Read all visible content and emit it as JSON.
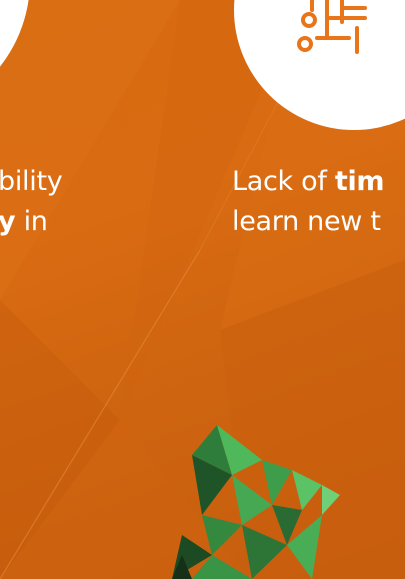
{
  "captions": {
    "left_line1_tail": "bility",
    "left_line2_bold": "y",
    "left_line2_tail": " in",
    "right_line1_lead": "Lack of ",
    "right_line1_bold": "tim",
    "right_line2": "learn new t"
  },
  "icons": {
    "right_circle": "circuit-icon"
  },
  "colors": {
    "background": "#d96b12",
    "icon_orange": "#e8751a",
    "circle": "#ffffff",
    "character_green": "#3fa34d"
  }
}
